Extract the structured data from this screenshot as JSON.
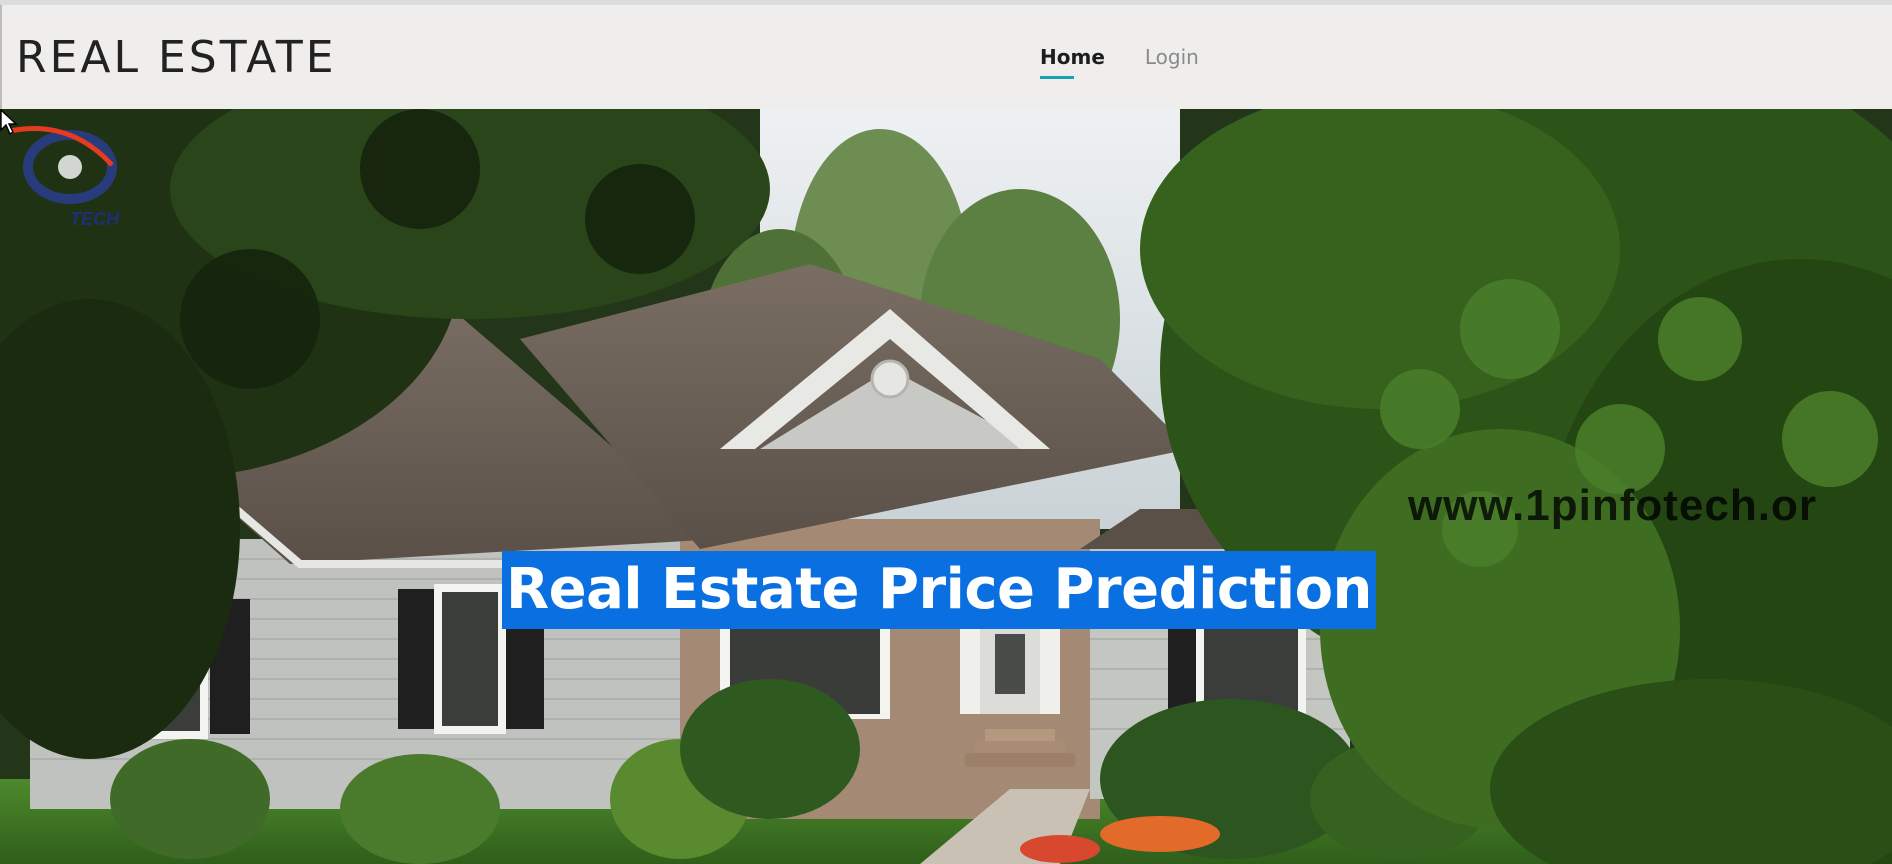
{
  "brand": {
    "name": "REAL ESTATE"
  },
  "nav": {
    "items": [
      {
        "label": "Home",
        "active": true
      },
      {
        "label": "Login",
        "active": false
      }
    ]
  },
  "hero": {
    "title": "Real Estate Price Prediction",
    "watermark": "www.1pinfotech.or"
  },
  "logo": {
    "text": "TECH"
  },
  "colors": {
    "navbar_bg": "#efeeec",
    "accent": "#1aa0b2",
    "title_highlight": "#0a6fe0"
  },
  "icons": {
    "cursor": "cursor-arrow-icon",
    "logo": "brand-logo-icon"
  }
}
